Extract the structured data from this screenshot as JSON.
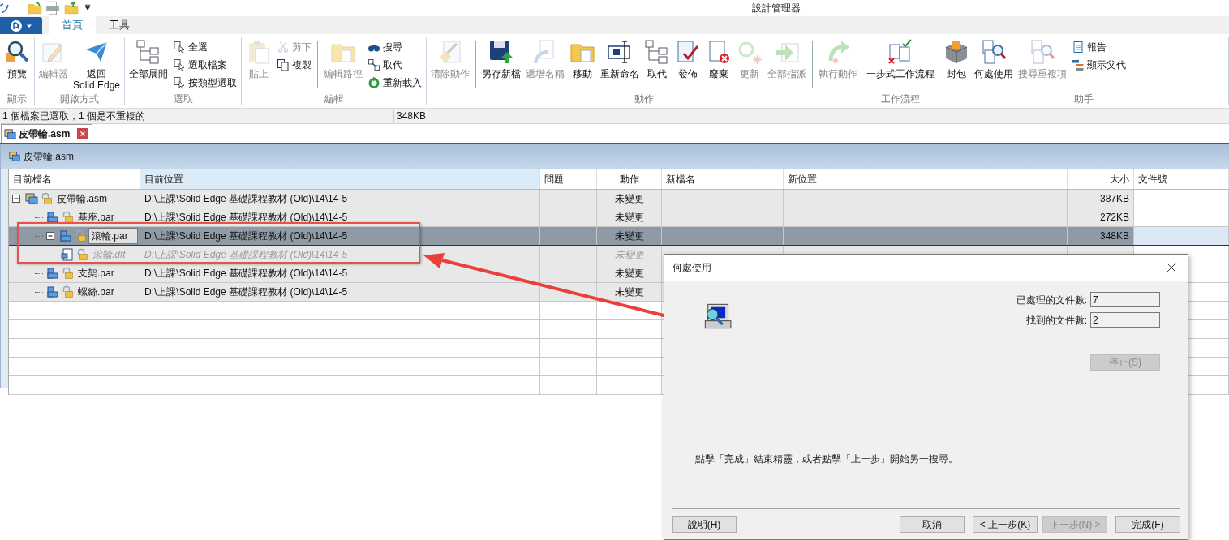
{
  "window": {
    "title": "設計管理器"
  },
  "menu_tabs": [
    {
      "label": "首頁",
      "selected": true
    },
    {
      "label": "工具",
      "selected": false
    }
  ],
  "ribbon": {
    "groups": [
      {
        "label": "顯示",
        "items": [
          {
            "label": "預覽",
            "kind": "large",
            "disabled": false
          }
        ]
      },
      {
        "label": "開啟方式",
        "items": [
          {
            "label": "編輯器",
            "kind": "large",
            "disabled": true
          },
          {
            "label": "返回\nSolid Edge",
            "kind": "large",
            "disabled": false
          }
        ]
      },
      {
        "label": "選取",
        "items": [
          {
            "label": "全部展開",
            "kind": "large",
            "disabled": false
          },
          {
            "label": "全選",
            "kind": "small",
            "disabled": false
          },
          {
            "label": "選取檔案",
            "kind": "small",
            "disabled": false
          },
          {
            "label": "按類型選取",
            "kind": "small",
            "disabled": false
          }
        ]
      },
      {
        "label": "編輯",
        "items": [
          {
            "label": "貼上",
            "kind": "large",
            "disabled": true
          },
          {
            "label": "剪下",
            "kind": "small",
            "disabled": true
          },
          {
            "label": "複製",
            "kind": "small",
            "disabled": false
          },
          {
            "kind": "separator"
          },
          {
            "label": "編輯路徑",
            "kind": "large",
            "disabled": true
          },
          {
            "label": "搜尋",
            "kind": "small",
            "disabled": false
          },
          {
            "label": "取代",
            "kind": "small",
            "disabled": false
          },
          {
            "label": "重新載入",
            "kind": "small",
            "disabled": false
          }
        ]
      },
      {
        "label": "動作",
        "items": [
          {
            "label": "清除動作",
            "kind": "large",
            "disabled": true
          },
          {
            "kind": "separator"
          },
          {
            "label": "另存新檔",
            "kind": "large",
            "disabled": false
          },
          {
            "label": "遞增名稱",
            "kind": "large",
            "disabled": true
          },
          {
            "label": "移動",
            "kind": "large",
            "disabled": false
          },
          {
            "label": "重新命名",
            "kind": "large",
            "disabled": false
          },
          {
            "label": "取代",
            "kind": "large",
            "disabled": false
          },
          {
            "label": "發佈",
            "kind": "large",
            "disabled": false
          },
          {
            "label": "廢棄",
            "kind": "large",
            "disabled": false
          },
          {
            "label": "更新",
            "kind": "large",
            "disabled": true
          },
          {
            "label": "全部指派",
            "kind": "large",
            "disabled": true
          },
          {
            "kind": "separator"
          },
          {
            "label": "執行動作",
            "kind": "large",
            "disabled": true
          }
        ]
      },
      {
        "label": "工作流程",
        "items": [
          {
            "label": "一步式工作流程",
            "kind": "large",
            "disabled": false
          }
        ]
      },
      {
        "label": "助手",
        "items": [
          {
            "label": "封包",
            "kind": "large",
            "disabled": false
          },
          {
            "label": "何處使用",
            "kind": "large",
            "disabled": false
          },
          {
            "label": "搜尋重複項",
            "kind": "large",
            "disabled": true
          },
          {
            "label": "報告",
            "kind": "small",
            "disabled": false
          },
          {
            "label": "顯示父代",
            "kind": "small",
            "disabled": false
          }
        ]
      }
    ]
  },
  "status_bar": {
    "selection": "1 個檔案已選取，1 個是不重複的",
    "size": "348KB"
  },
  "document_tabs": [
    {
      "label": "皮帶輪.asm",
      "selected": true
    }
  ],
  "panel": {
    "title": "皮帶輪.asm"
  },
  "table": {
    "columns": [
      {
        "label": "目前檔名",
        "sorted": false
      },
      {
        "label": "目前位置",
        "sorted": true
      },
      {
        "label": "問題",
        "sorted": false
      },
      {
        "label": "動作",
        "sorted": false
      },
      {
        "label": "新檔名",
        "sorted": false
      },
      {
        "label": "新位置",
        "sorted": false
      },
      {
        "label": "大小",
        "sorted": false
      },
      {
        "label": "文件號",
        "sorted": false
      }
    ],
    "rows": [
      {
        "name": "皮帶輪.asm",
        "kind": "asm",
        "location": "D:\\上課\\Solid Edge 基礎課程教材 (Old)\\14\\14-5",
        "action": "未變更",
        "size": "387KB",
        "expanded": true,
        "selected": false,
        "dimmed": false,
        "children": [
          {
            "name": "基座.par",
            "kind": "par",
            "location": "D:\\上課\\Solid Edge 基礎課程教材 (Old)\\14\\14-5",
            "action": "未變更",
            "size": "272KB",
            "selected": false,
            "dimmed": false
          },
          {
            "name": "滾輪.par",
            "kind": "par",
            "location": "D:\\上課\\Solid Edge 基礎課程教材 (Old)\\14\\14-5",
            "action": "未變更",
            "size": "348KB",
            "expanded": true,
            "selected": true,
            "dimmed": false,
            "children": [
              {
                "name": "滾輪.dft",
                "kind": "dft",
                "location": "D:\\上課\\Solid Edge 基礎課程教材 (Old)\\14\\14-5",
                "action": "未變更",
                "selected": false,
                "dimmed": true
              }
            ]
          },
          {
            "name": "支架.par",
            "kind": "par",
            "location": "D:\\上課\\Solid Edge 基礎課程教材 (Old)\\14\\14-5",
            "action": "未變更",
            "selected": false,
            "dimmed": false
          },
          {
            "name": "螺絲.par",
            "kind": "par",
            "location": "D:\\上課\\Solid Edge 基礎課程教材 (Old)\\14\\14-5",
            "action": "未變更",
            "selected": false,
            "dimmed": false
          }
        ]
      }
    ]
  },
  "dialog": {
    "title": "何處使用",
    "fields": [
      {
        "label": "已處理的文件數:",
        "value": "7"
      },
      {
        "label": "找到的文件數:",
        "value": "2"
      }
    ],
    "stop_button": {
      "label": "停止(S)",
      "disabled": true
    },
    "message": "點擊「完成」結束精靈，或者點擊「上一步」開始另一搜尋。",
    "buttons": [
      {
        "label": "說明(H)",
        "disabled": false
      },
      {
        "label": "取消",
        "disabled": false
      },
      {
        "label": "< 上一步(K)",
        "disabled": false
      },
      {
        "label": "下一步(N) >",
        "disabled": true
      },
      {
        "label": "完成(F)",
        "disabled": false
      }
    ]
  }
}
